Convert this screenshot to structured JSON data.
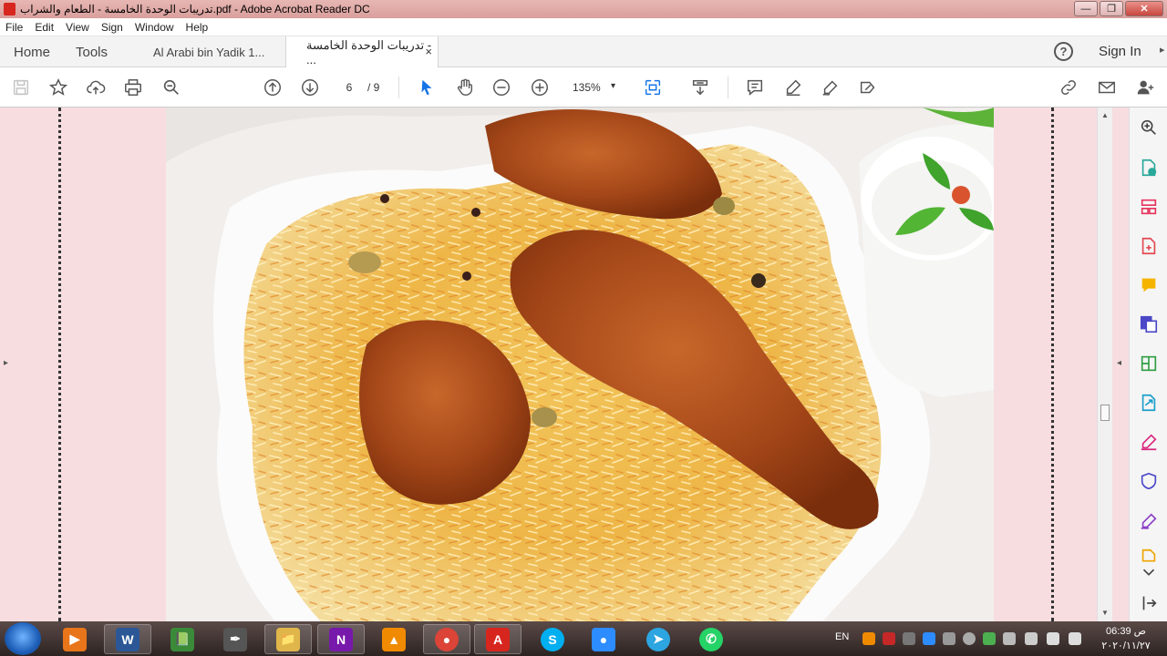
{
  "window": {
    "title": "تدريبات الوحدة الخامسة - الطعام والشراب.pdf - Adobe Acrobat Reader DC",
    "minimize": "—",
    "maximize": "❐",
    "close": "✕"
  },
  "menu": [
    "File",
    "Edit",
    "View",
    "Sign",
    "Window",
    "Help"
  ],
  "tabs": {
    "home": "Home",
    "tools": "Tools",
    "doc1": "Al Arabi bin Yadik 1...",
    "doc2": "تدريبات الوحدة الخامسة - ...",
    "close": "×"
  },
  "header": {
    "help": "?",
    "signin": "Sign In",
    "more": "▸"
  },
  "toolbar": {
    "page_current": "6",
    "page_total": "/ 9",
    "zoom": "135%",
    "zoom_caret": "▾"
  },
  "nav": {
    "left_arrow": "▸",
    "right_arrow": "◂",
    "scroll_up": "▲",
    "scroll_down": "▼"
  },
  "taskbar": {
    "lang": "EN",
    "time": "06:39 ص",
    "date": "٢٠٢٠/١١/٢٧",
    "apps": [
      {
        "name": "media",
        "label": "▶",
        "color": "#e8751a"
      },
      {
        "name": "word",
        "label": "W",
        "color": "#2b5797"
      },
      {
        "name": "app-green",
        "label": "📗",
        "color": "#3a8a3a"
      },
      {
        "name": "pen",
        "label": "✒",
        "color": "#555555"
      },
      {
        "name": "explorer",
        "label": "📁",
        "color": "#e0b64a"
      },
      {
        "name": "onenote",
        "label": "N",
        "color": "#7719aa"
      },
      {
        "name": "vlc",
        "label": "▲",
        "color": "#f08a00"
      },
      {
        "name": "chrome",
        "label": "●",
        "color": "#db4437"
      },
      {
        "name": "acrobat",
        "label": "A",
        "color": "#d7261e"
      },
      {
        "name": "skype",
        "label": "S",
        "color": "#00aff0"
      },
      {
        "name": "zoom",
        "label": "●",
        "color": "#2d8cff"
      },
      {
        "name": "telegram",
        "label": "➤",
        "color": "#2ca5e0"
      },
      {
        "name": "whatsapp",
        "label": "✆",
        "color": "#25d366"
      }
    ]
  },
  "colors": {
    "doc_background": "#f7dde0",
    "acrobat_red": "#d7261e",
    "accent_blue": "#1473e6"
  }
}
